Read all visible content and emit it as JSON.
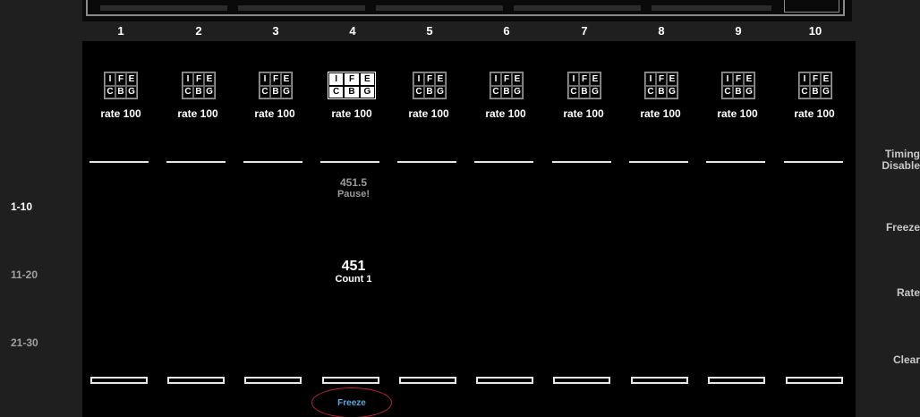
{
  "columns": [
    {
      "number": "1",
      "rate": "rate 100"
    },
    {
      "number": "2",
      "rate": "rate 100"
    },
    {
      "number": "3",
      "rate": "rate 100"
    },
    {
      "number": "4",
      "rate": "rate 100",
      "active": true
    },
    {
      "number": "5",
      "rate": "rate 100"
    },
    {
      "number": "6",
      "rate": "rate 100"
    },
    {
      "number": "7",
      "rate": "rate 100"
    },
    {
      "number": "8",
      "rate": "rate 100"
    },
    {
      "number": "9",
      "rate": "rate 100"
    },
    {
      "number": "10",
      "rate": "rate 100"
    }
  ],
  "grid_letters": {
    "row1": [
      "I",
      "F",
      "E"
    ],
    "row2": [
      "C",
      "B",
      "G"
    ]
  },
  "pause": {
    "value": "451.5",
    "text": "Pause!"
  },
  "count": {
    "value": "451",
    "text": "Count 1"
  },
  "freeze_button": {
    "label": "Freeze"
  },
  "left_ranges": [
    {
      "label": "1-10",
      "active": true
    },
    {
      "label": "11-20",
      "active": false
    },
    {
      "label": "21-30",
      "active": false
    }
  ],
  "right_buttons": {
    "timing_line1": "Timing",
    "timing_line2": "Disable",
    "freeze": "Freeze",
    "rate": "Rate",
    "clear": "Clear"
  },
  "colors": {
    "background": "#1f1f1f",
    "panel": "#000000",
    "freeze_highlight": "#c0233a",
    "freeze_text": "#5aa8d8",
    "inactive_text": "#9a9a9a"
  }
}
